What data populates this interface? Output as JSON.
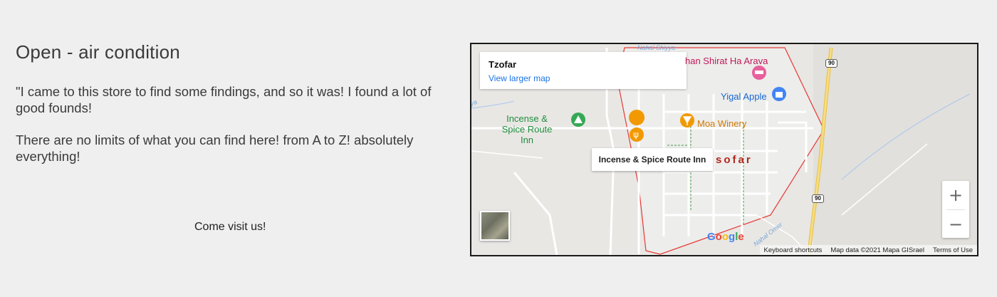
{
  "content": {
    "title": "Open - air condition",
    "paragraph1": "\"I came to this store to find some findings, and so it was! I found a lot of good founds!",
    "paragraph2": "There are no limits of what you can find here! from A to Z! absolutely everything!",
    "cta": "Come visit us!"
  },
  "map": {
    "place_name": "Tzofar",
    "view_larger": "View larger map",
    "labels": {
      "incense": "Incense & Spice Route Inn",
      "moa": "Moa Winery",
      "yigal": "Yigal Apple",
      "shirat": "han Shirat Ha Arava",
      "town": "sofar",
      "river1": "Nahal Shiyya",
      "river2": "yya",
      "river3": "Nahal Omer"
    },
    "tooltip": "Incense & Spice Route Inn",
    "route_badge_1": "90",
    "route_badge_2": "90",
    "google_logo": "Google",
    "footer": {
      "shortcuts": "Keyboard shortcuts",
      "mapdata": "Map data ©2021 Mapa GISrael",
      "terms": "Terms of Use"
    },
    "zoom_in": "+",
    "zoom_out": "−",
    "colors": {
      "boundary": "#e53935",
      "highway": "#f2c94c",
      "road": "#ffffff",
      "green_path": "#43a047"
    }
  }
}
